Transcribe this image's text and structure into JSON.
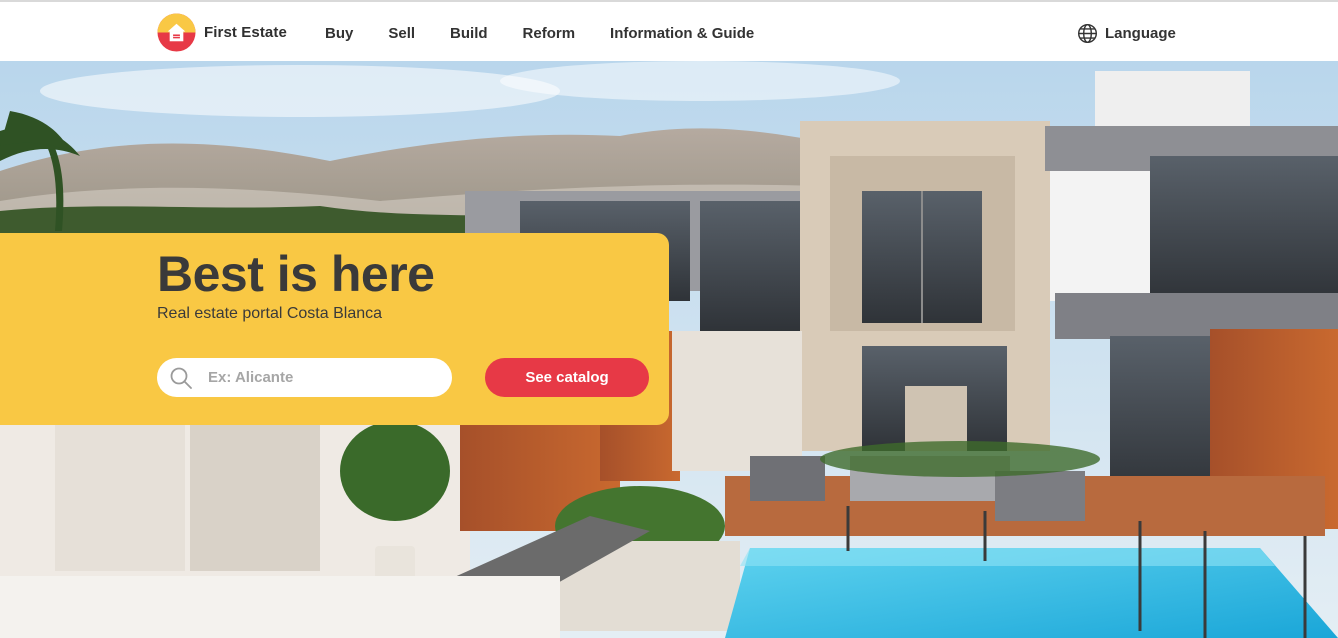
{
  "header": {
    "brand": "First Estate",
    "nav": [
      "Buy",
      "Sell",
      "Build",
      "Reform",
      "Information & Guide"
    ],
    "language_label": "Language"
  },
  "hero": {
    "title": "Best is here",
    "subtitle": "Real estate portal Costa Blanca",
    "search_placeholder": "Ex: Alicante",
    "search_value": "",
    "cta_label": "See catalog"
  },
  "colors": {
    "accent_yellow": "#f9c844",
    "accent_red": "#e73946",
    "text_dark": "#333333"
  },
  "icons": [
    "house-logo-icon",
    "globe-icon",
    "search-icon"
  ]
}
